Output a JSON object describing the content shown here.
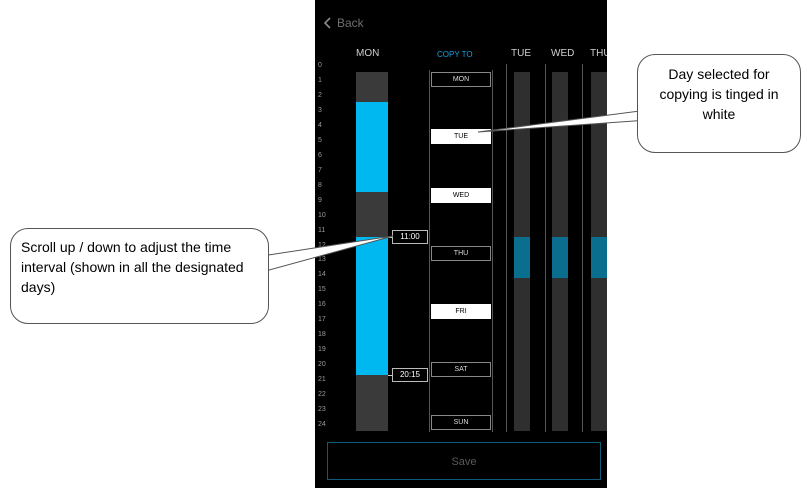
{
  "nav": {
    "back_label": "Back"
  },
  "headers": {
    "mon": "MON",
    "copy_to": "COPY TO",
    "tue": "TUE",
    "wed": "WED",
    "thu": "THU"
  },
  "hours": [
    "0",
    "1",
    "2",
    "3",
    "4",
    "5",
    "6",
    "7",
    "8",
    "9",
    "10",
    "11",
    "12",
    "13",
    "14",
    "15",
    "16",
    "17",
    "18",
    "19",
    "20",
    "21",
    "22",
    "23",
    "24"
  ],
  "schedule": {
    "mon_intervals": [
      {
        "start": 2,
        "end": 8
      },
      {
        "start": 11,
        "end": 20.25
      }
    ],
    "start_label": "11:00",
    "end_label": "20:15",
    "copied_interval": {
      "start": 11,
      "end": 13.8
    }
  },
  "copy_days": [
    {
      "label": "MON",
      "selected": false
    },
    {
      "label": "TUE",
      "selected": true
    },
    {
      "label": "WED",
      "selected": true
    },
    {
      "label": "THU",
      "selected": false
    },
    {
      "label": "FRI",
      "selected": true
    },
    {
      "label": "SAT",
      "selected": false
    },
    {
      "label": "SUN",
      "selected": false
    }
  ],
  "save_label": "Save",
  "callouts": {
    "scroll": "Scroll up / down to adjust the time interval (shown in all the designated days)",
    "day_selected": "Day selected  for copying is tinged in white"
  },
  "colors": {
    "active": "#00b8f0",
    "copied": "#0a6f8f",
    "track": "#3a3a3a",
    "accent": "#1aa0e0",
    "background": "#000000"
  }
}
